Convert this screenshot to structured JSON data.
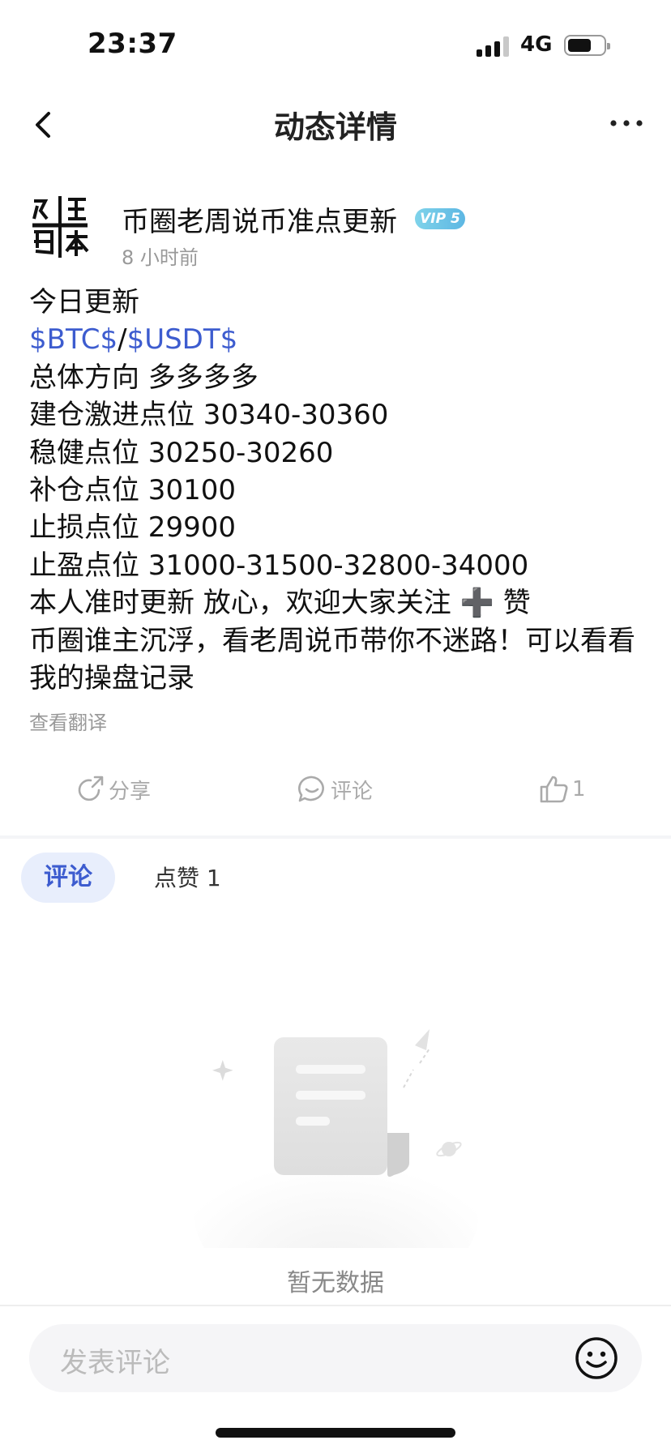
{
  "status_bar": {
    "time": "23:37",
    "network": "4G"
  },
  "nav": {
    "title": "动态详情"
  },
  "post": {
    "author": "币圈老周说币准点更新",
    "vip_badge": "VIP 5",
    "time_ago": "8 小时前",
    "lines": {
      "l1": "今日更新",
      "ticker1": "$BTC$",
      "slash": "/",
      "ticker2": "$USDT$",
      "l3": "总体方向 多多多多",
      "l4": "建仓激进点位 30340-30360",
      "l5": "稳健点位 30250-30260",
      "l6": "补仓点位 30100",
      "l7": "止损点位 29900",
      "l8": "止盈点位 31000-31500-32800-34000",
      "l9": "本人准时更新 放心，欢迎大家关注 ➕ 赞",
      "l10": "币圈谁主沉浮，看老周说币带你不迷路！可以看看我的操盘记录"
    },
    "translate_label": "查看翻译"
  },
  "actions": {
    "share": "分享",
    "comment": "评论",
    "like_count": "1"
  },
  "tabs": {
    "comments": "评论",
    "likes": "点赞 1"
  },
  "empty": {
    "text": "暂无数据"
  },
  "input": {
    "placeholder": "发表评论"
  },
  "colors": {
    "accent": "#3d5ccf",
    "muted": "#999999",
    "tab_bg": "#e8eefc"
  }
}
